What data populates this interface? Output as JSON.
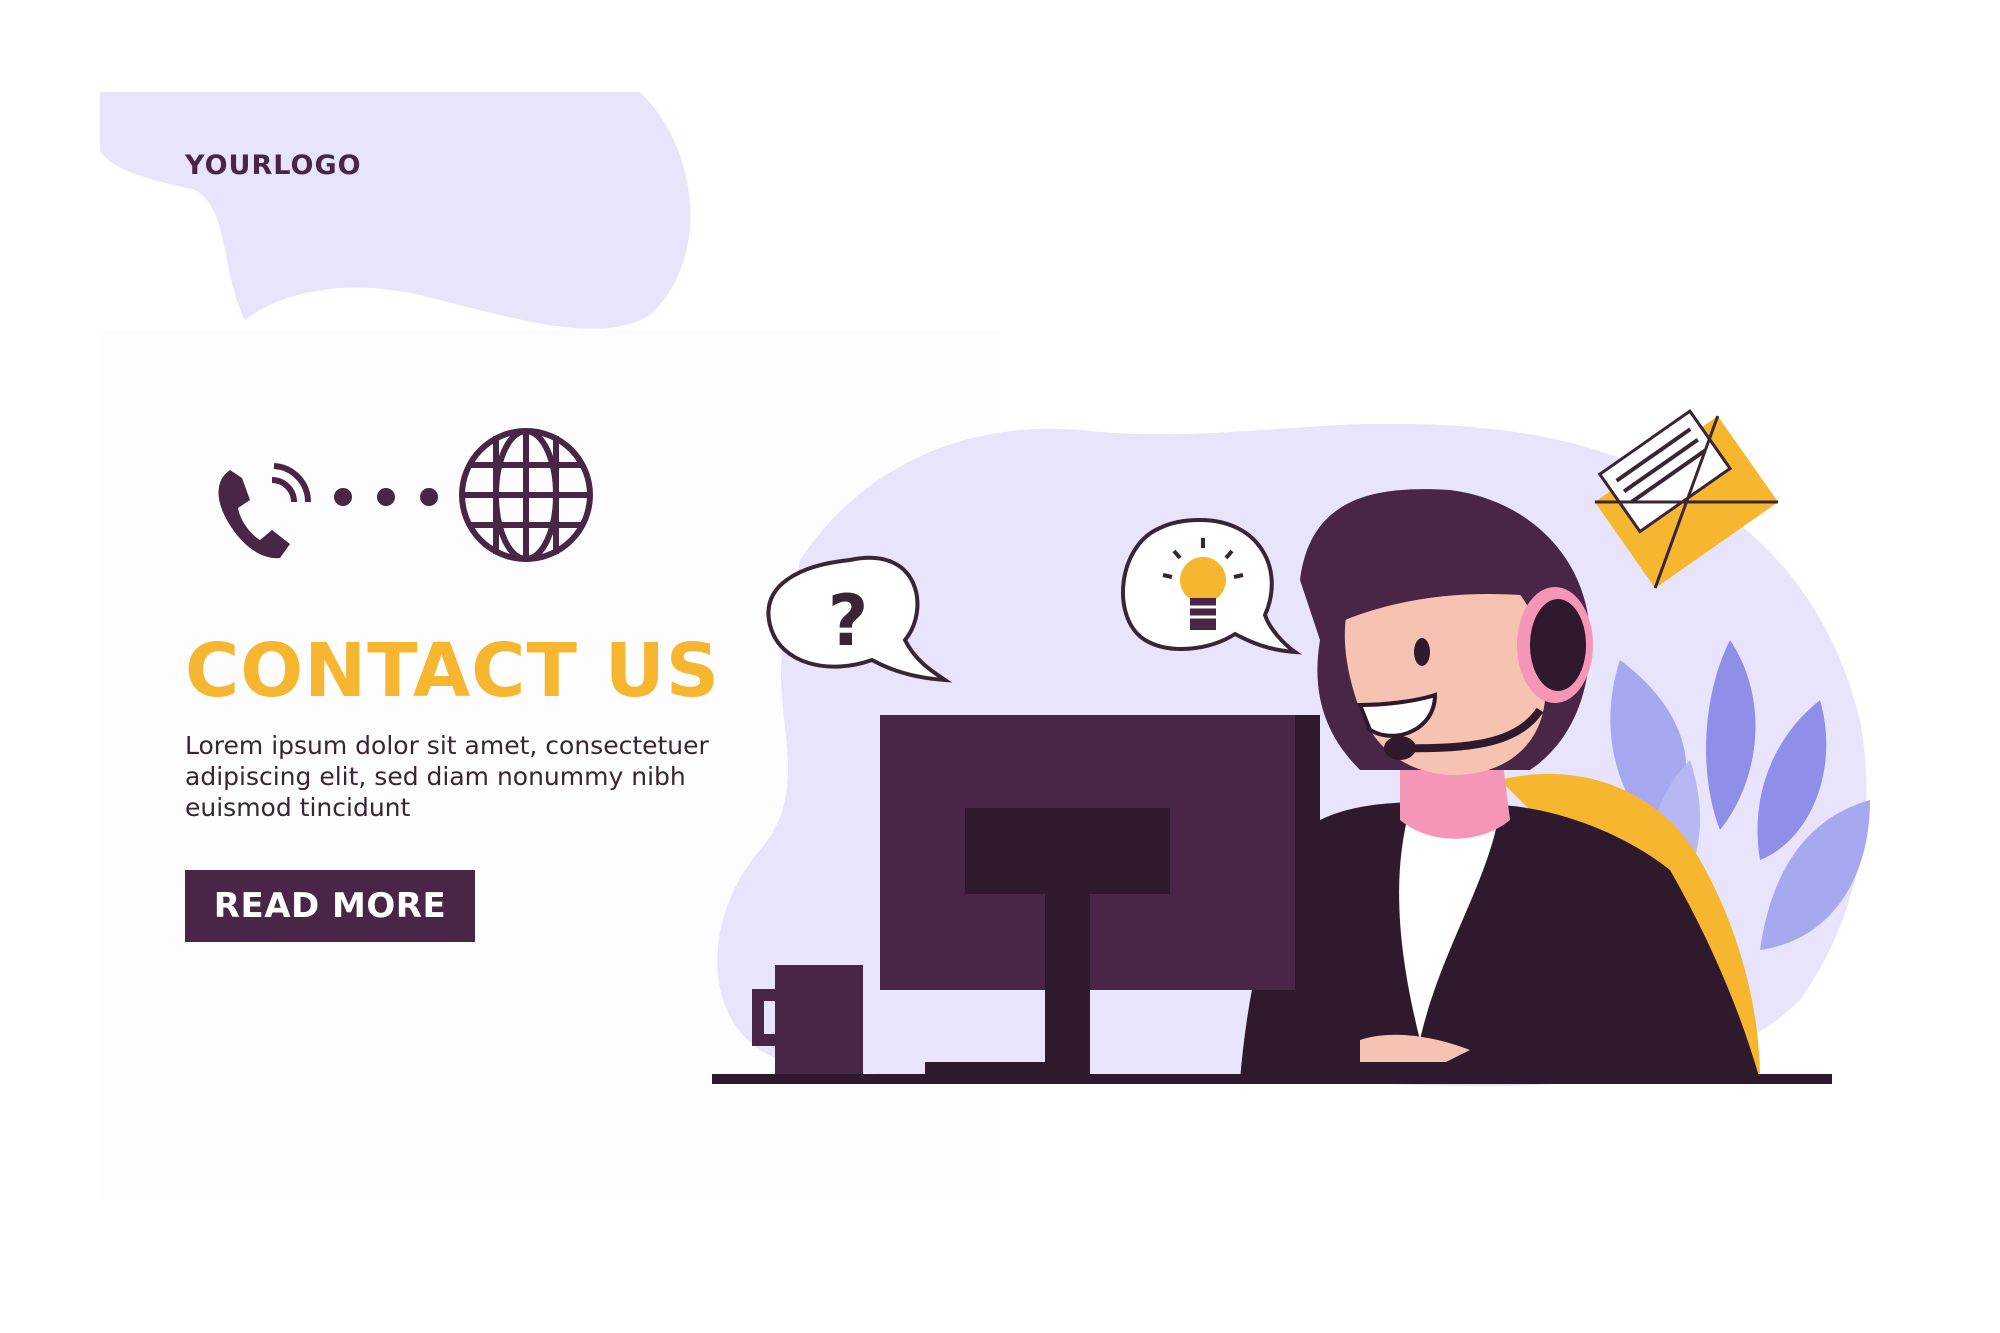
{
  "brand": {
    "logo_text": "YOURLOGO"
  },
  "hero": {
    "title": "CONTACT US",
    "body_lines": [
      "Lorem ipsum dolor sit amet, consectetuer",
      "adipiscing elit, sed diam nonummy nibh",
      "euismod tincidunt"
    ],
    "read_more_label": "READ MORE"
  },
  "illustration": {
    "question_bubble_text": "?",
    "icons": [
      "phone-icon",
      "dots-icon",
      "globe-icon",
      "question-bubble-icon",
      "lightbulb-bubble-icon",
      "envelope-icon"
    ]
  },
  "colors": {
    "accent_yellow": "#f6b62f",
    "dark_purple": "#4a2646",
    "lavender": "#e7e4fb",
    "leaf_purple": "#8f8ee8",
    "skin": "#f6c2b2",
    "headset_pink": "#f596b8"
  }
}
